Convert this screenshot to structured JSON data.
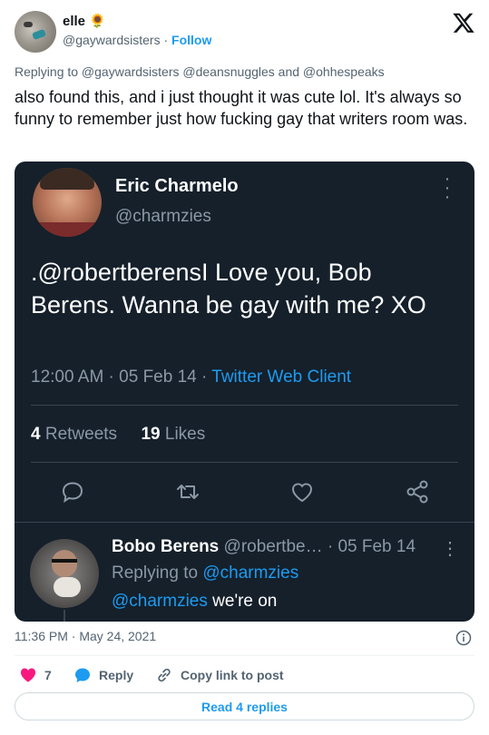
{
  "author": {
    "name": "elle",
    "emoji": "🌻",
    "handle": "@gaywardsisters",
    "dot": "·",
    "follow_label": "Follow"
  },
  "replying_to": "Replying to @gaywardsisters @deansnuggles and @ohhespeaks",
  "body": "also found this, and i just thought it was cute lol. It's always so funny to remember just how fucking gay that writers room was.",
  "embed": {
    "name": "Eric Charmelo",
    "handle": "@charmzies",
    "text": ".@robertberensI Love you, Bob Berens.  Wanna be gay with me? XO",
    "meta_time": "12:00 AM · 05 Feb 14 · ",
    "meta_client": "Twitter Web Client",
    "retweets_count": "4",
    "retweets_label": " Retweets",
    "likes_count": "19",
    "likes_label": " Likes",
    "reply": {
      "name": "Bobo Berens",
      "handle_date": " @robertbe… · 05 Feb 14",
      "replying_prefix": "Replying to ",
      "replying_link": "@charmzies",
      "text_link": "@charmzies",
      "text_rest": " we're on"
    }
  },
  "timestamp": "11:36 PM · May 24, 2021",
  "actions": {
    "likes_count": "7",
    "reply_label": "Reply",
    "copy_label": "Copy link to post"
  },
  "read_replies_label": "Read 4 replies",
  "colors": {
    "accent": "#1d9bf0",
    "heart": "#f91880",
    "embed_bg": "#15202b"
  }
}
